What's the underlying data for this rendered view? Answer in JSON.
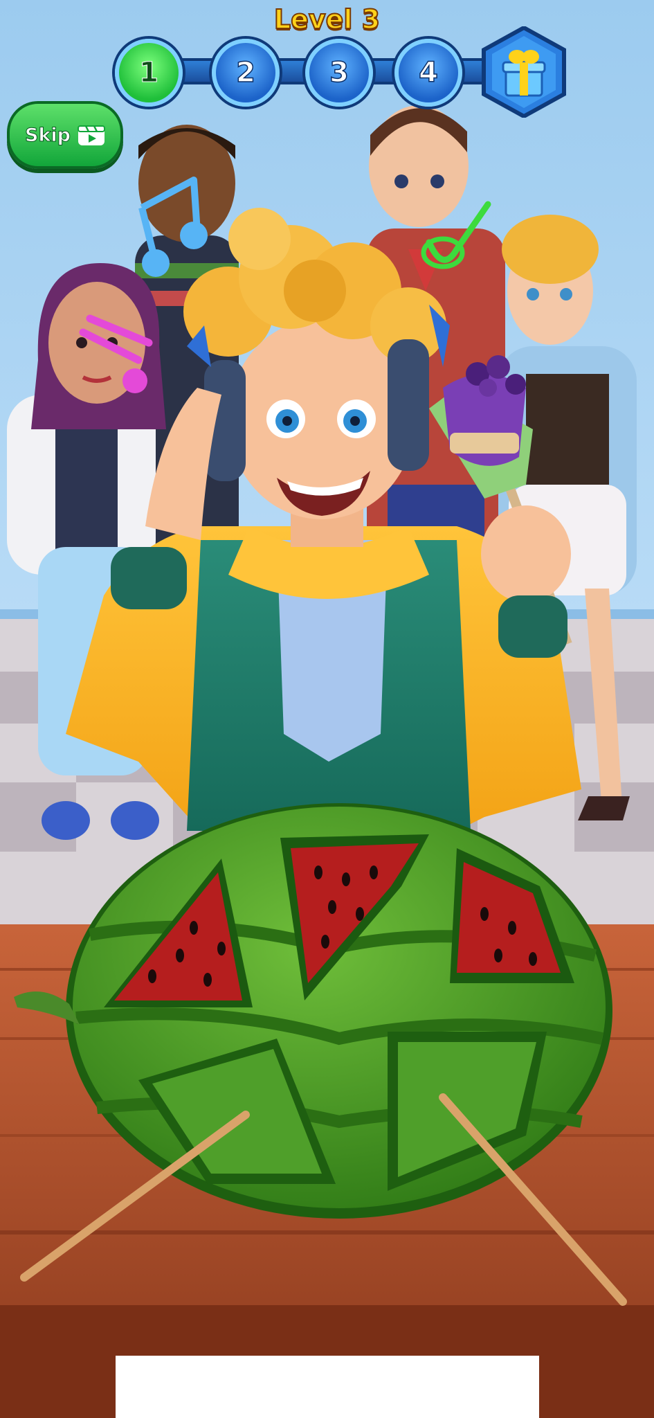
{
  "hud": {
    "level_title": "Level 3",
    "progress": {
      "steps": [
        "1",
        "2",
        "3",
        "4"
      ],
      "current_step": 1,
      "fill_fraction": 0.1,
      "reward_icon": "gift-box-icon"
    },
    "skip_label": "Skip",
    "skip_icon": "video-ad-icon"
  },
  "scene": {
    "characters": [
      {
        "name": "girl-purple-hair",
        "reaction_icon": "music-note-icon"
      },
      {
        "name": "boy-dark-skin",
        "reaction_icon": "music-note-icon"
      },
      {
        "name": "man-glasses-vest",
        "reaction_icon": "checkmark-icon"
      },
      {
        "name": "girl-blonde-denim"
      },
      {
        "name": "main-boy-curly-hair",
        "holding": "cake-popsicle"
      }
    ],
    "table_object": "watermelon-with-cut-slots",
    "tools": [
      "chopstick-left",
      "chopstick-right"
    ]
  },
  "colors": {
    "sky": "#8fc3ec",
    "wall": "#a7d3f5",
    "floor_light": "#d9d3d8",
    "floor_dark": "#bdb4bc",
    "table": "#b5532e",
    "melon_green": "#3f8f22",
    "melon_flesh": "#b51e1e",
    "level_gold": "#ffd21a",
    "skip_green": "#1fbf3a"
  }
}
